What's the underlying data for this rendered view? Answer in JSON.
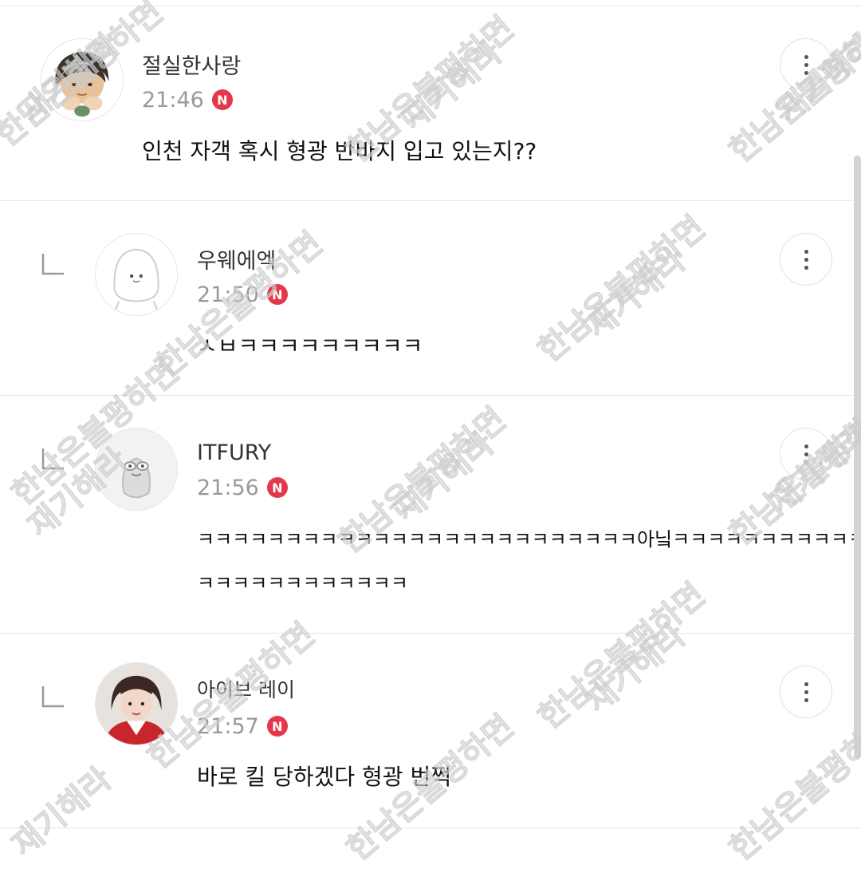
{
  "comments": [
    {
      "username": "절실한사랑",
      "time": "21:46",
      "badge": "N",
      "text": "인천 자객 혹시 형광 반바지 입고 있는지??",
      "is_reply": false
    },
    {
      "username": "우웨에엑",
      "time": "21:50",
      "badge": "N",
      "text": "ㅅㅂㅋㅋㅋㅋㅋㅋㅋㅋㅋ",
      "is_reply": true
    },
    {
      "username": "ITFURY",
      "time": "21:56",
      "badge": "N",
      "text_line1": "ㅋㅋㅋㅋㅋㅋㅋㅋㅋㅋㅋㅋㅋㅋㅋㅋㅋㅋㅋㅋㅋㅋㅋㅋㅋ아닠ㅋㅋㅋㅋㅋㅋㅋㅋㅋㅋㅋ",
      "text_line2": "ㅋㅋㅋㅋㅋㅋㅋㅋㅋㅋㅋㅋ",
      "is_reply": true
    },
    {
      "username": "아이브 레이",
      "time": "21:57",
      "badge": "N",
      "text": "바로 킬 당하겠다 형광 번쩍",
      "is_reply": true
    }
  ],
  "watermark": {
    "line1": "한남은불평하면",
    "line2": "재기해라"
  },
  "icons": {
    "more": "more-vertical-icon",
    "reply": "reply-indent-icon",
    "new_badge": "new-badge-icon"
  },
  "colors": {
    "badge": "#e5374b",
    "time": "#999999",
    "username": "#333333",
    "text": "#111111"
  }
}
